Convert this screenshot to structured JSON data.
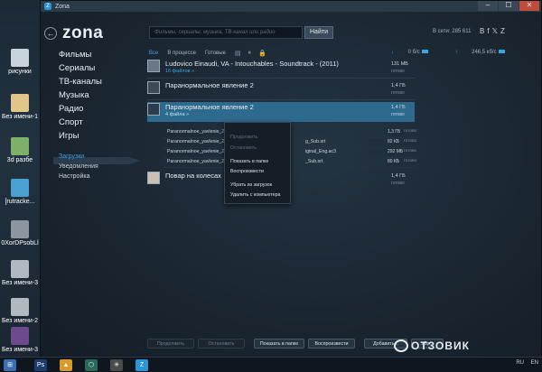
{
  "window": {
    "title": "Zona",
    "min": "–",
    "max": "☐",
    "close": "✕"
  },
  "header": {
    "back_icon": "back-arrow-icon",
    "logo": "zona",
    "search_placeholder": "Фильмы, сериалы, музыка, ТВ-канал или радио",
    "search_button": "Найти",
    "online": "В сети: 285 611",
    "social": [
      "В",
      "f",
      "𝕏",
      "Z"
    ]
  },
  "menu": {
    "main": [
      "Фильмы",
      "Сериалы",
      "ТВ-каналы",
      "Музыка",
      "Радио",
      "Спорт",
      "Игры"
    ],
    "sub": [
      "Загрузки",
      "Уведомления",
      "Настройка"
    ]
  },
  "filters": {
    "all": "Все",
    "in_progress": "В процессе",
    "done": "Готовые"
  },
  "speeds": {
    "down": "0 б/с",
    "up": "246,5 кб/с"
  },
  "downloads": [
    {
      "name": "Ludovico Einaudi, VA - Intouchables - Soundtrack - (2011)",
      "sub": "16 файлов »",
      "size": "131 МБ",
      "state": "готово"
    },
    {
      "name": "Паранормальное явление 2",
      "sub": "",
      "size": "1,4 ГБ",
      "state": "готово"
    },
    {
      "name": "Паранормальное явление 2",
      "sub": "4 файла »",
      "size": "1,4 ГБ",
      "state": "готово"
    },
    {
      "name": "Повар на колесах",
      "sub": "",
      "size": "1,4 ГБ",
      "state": "готово"
    }
  ],
  "files": [
    {
      "name": "Paranormalnoe_yavlenie_2_2",
      "extra": "",
      "size": "1,3 ГБ",
      "state": "готово"
    },
    {
      "name": "Paranormalnoe_yavlenie_2_2",
      "extra": "g_Sub.srt",
      "size": "82 КБ",
      "state": "готово"
    },
    {
      "name": "Paranormalnoe_yavlenie_2_2",
      "extra": "iginal_Eng.ac3",
      "size": "292 МБ",
      "state": "готово"
    },
    {
      "name": "Paranormalnoe_yavlenie_2_2",
      "extra": "_Sub.srt",
      "size": "80 КБ",
      "state": "готово"
    }
  ],
  "context_menu": [
    {
      "label": "Продолжить",
      "enabled": false
    },
    {
      "label": "Остановить",
      "enabled": false
    },
    {
      "label": "Показать в папке",
      "enabled": true
    },
    {
      "label": "Воспроизвести",
      "enabled": true
    },
    {
      "label": "Убрать из загрузок",
      "enabled": true
    },
    {
      "label": "Удалить с компьютера",
      "enabled": true
    }
  ],
  "bottom_buttons": [
    {
      "label": "Продолжить",
      "enabled": false
    },
    {
      "label": "Остановить",
      "enabled": false
    },
    {
      "label": "Показать в папке",
      "enabled": true
    },
    {
      "label": "Воспроизвести",
      "enabled": true
    },
    {
      "label": "Добавить...",
      "enabled": true
    },
    {
      "label": "Убр...",
      "enabled": true
    }
  ],
  "desktop_icons": [
    "рисунки",
    "Без имени-1",
    "3d разбе",
    "[rutracke...",
    "0XorDPsobLl",
    "Без имени-3",
    "Без имени-2",
    "Без имени-3"
  ],
  "taskbar": {
    "apps": [
      "Ps",
      "▲",
      "⬡",
      "✳",
      "Z"
    ],
    "tray": [
      "RU",
      "EN"
    ]
  },
  "watermark": "ОТЗОВИК"
}
